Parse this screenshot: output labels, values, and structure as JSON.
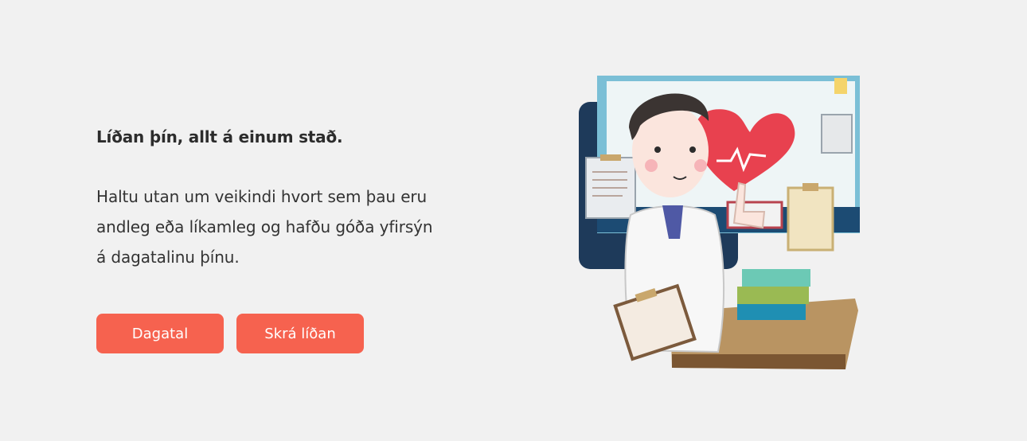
{
  "hero": {
    "headline": "Líðan þín, allt á einum stað.",
    "description": "Haltu utan um veikindi hvort sem þau eru andleg eða líkamleg og hafðu góða yfirsýn á dagatalinu þínu.",
    "buttons": {
      "calendar_label": "Dagatal",
      "log_label": "Skrá líðan"
    }
  },
  "colors": {
    "background": "#f1f1f1",
    "accent": "#f6624f",
    "text": "#333333"
  },
  "illustration": {
    "icon": "doctor-illustration"
  }
}
